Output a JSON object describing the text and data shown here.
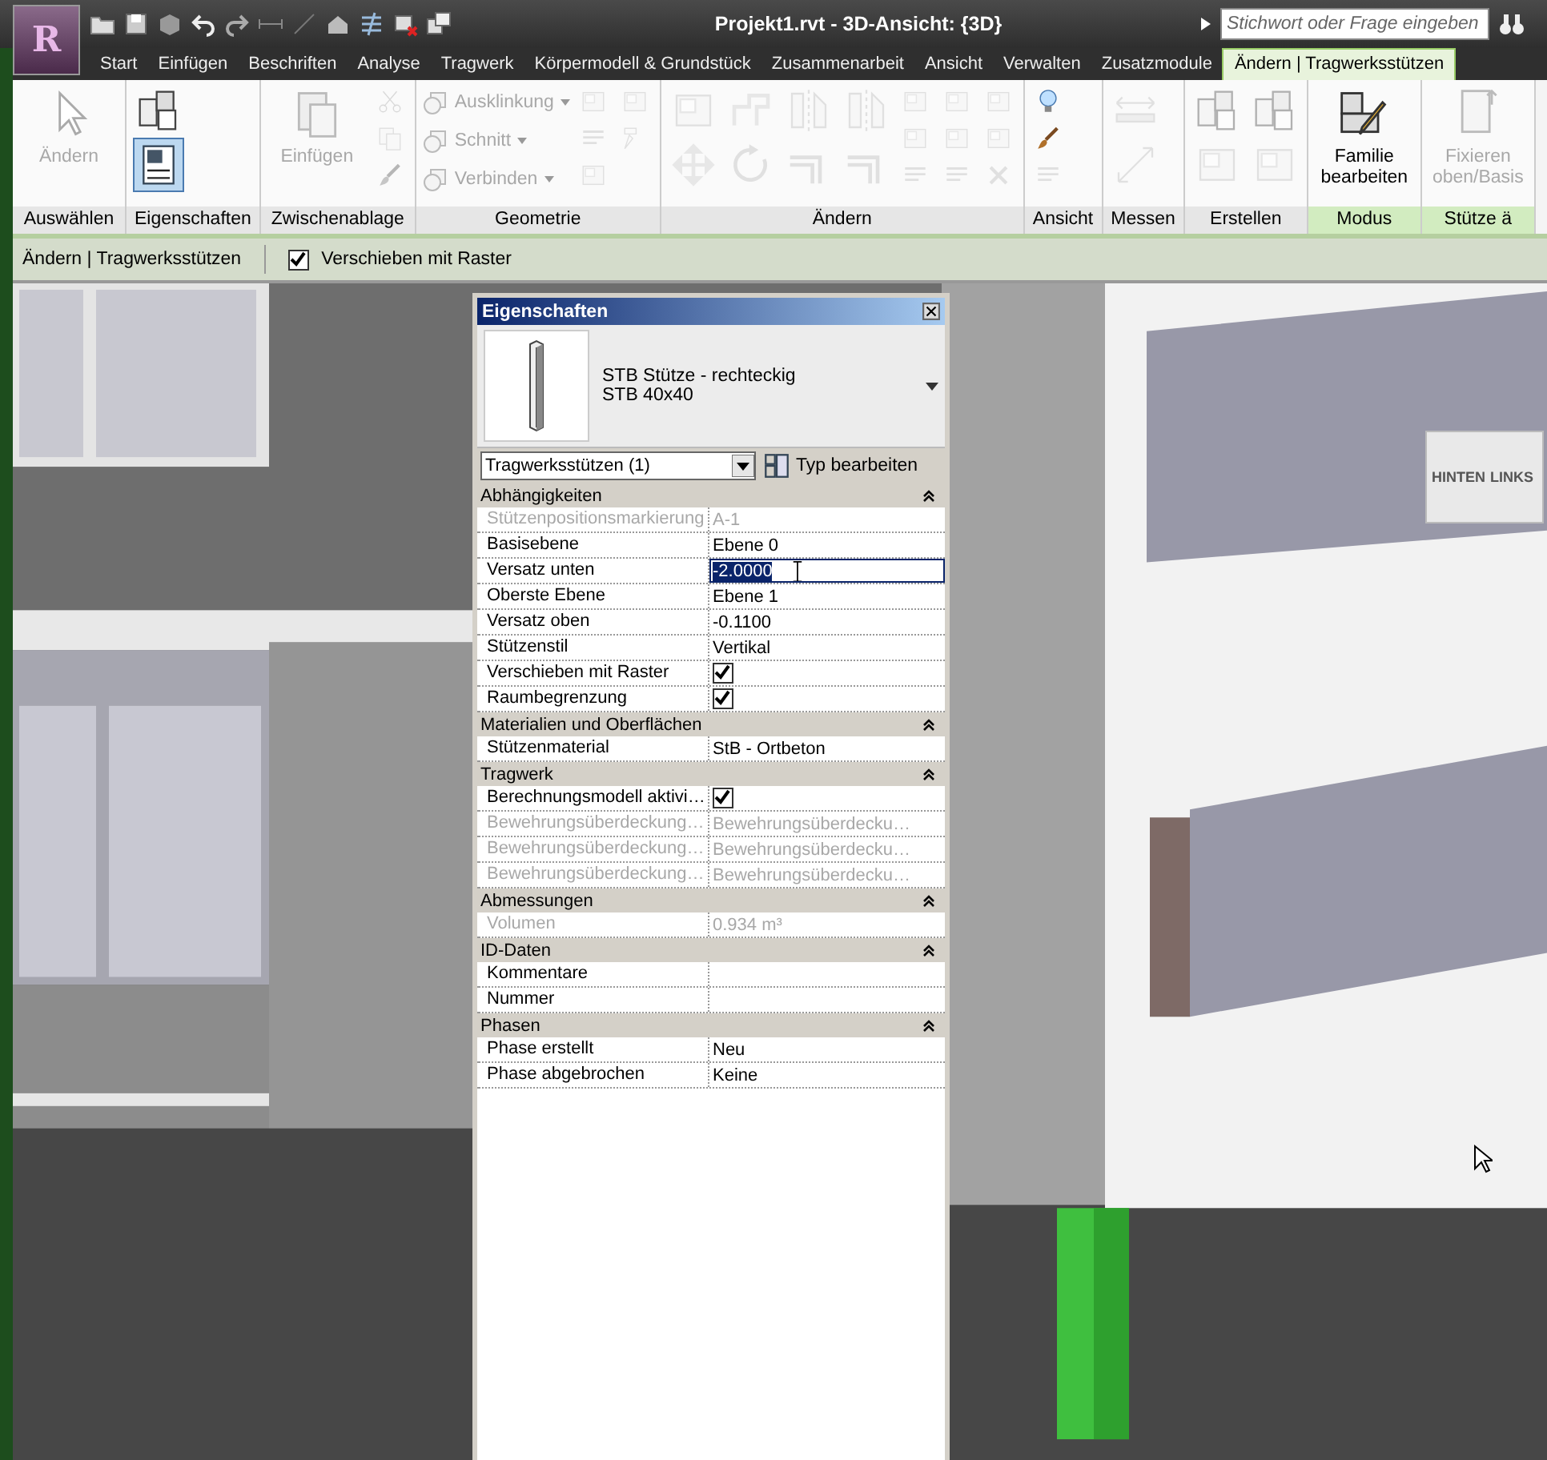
{
  "app_button": {
    "logo": "R"
  },
  "window": {
    "title": "Projekt1.rvt - 3D-Ansicht: {3D}"
  },
  "search": {
    "placeholder": "Stichwort oder Frage eingeben"
  },
  "tabs": [
    {
      "label": "Start",
      "selected": false
    },
    {
      "label": "Einfügen",
      "selected": false
    },
    {
      "label": "Beschriften",
      "selected": false
    },
    {
      "label": "Analyse",
      "selected": false
    },
    {
      "label": "Tragwerk",
      "selected": false
    },
    {
      "label": "Körpermodell & Grundstück",
      "selected": false
    },
    {
      "label": "Zusammenarbeit",
      "selected": false
    },
    {
      "label": "Ansicht",
      "selected": false
    },
    {
      "label": "Verwalten",
      "selected": false
    },
    {
      "label": "Zusatzmodule",
      "selected": false
    },
    {
      "label": "Ändern | Tragwerksstützen",
      "selected": true
    }
  ],
  "ribbon": {
    "panels": [
      {
        "title": "Auswählen",
        "contextual": false,
        "tools": [
          {
            "kind": "large",
            "label": "Ändern",
            "disabled": true,
            "pressed": false
          }
        ]
      },
      {
        "title": "Eigenschaften",
        "contextual": false,
        "tools": [
          {
            "kind": "bigicon",
            "disabled": false,
            "pressed": false
          },
          {
            "kind": "bigicon",
            "disabled": false,
            "pressed": true
          }
        ]
      },
      {
        "title": "Zwischenablage",
        "contextual": false,
        "tools": [
          {
            "kind": "large",
            "label": "Einfügen",
            "disabled": true,
            "pressed": false
          },
          {
            "kind": "icon",
            "disabled": true,
            "pressed": false
          },
          {
            "kind": "icon",
            "disabled": true,
            "pressed": false
          },
          {
            "kind": "icon",
            "disabled": true,
            "pressed": false
          }
        ]
      },
      {
        "title": "Geometrie",
        "contextual": false,
        "tools": [
          {
            "kind": "small",
            "label": "Ausklinkung",
            "disabled": true,
            "pressed": false
          },
          {
            "kind": "small",
            "label": "Schnitt",
            "disabled": true,
            "pressed": false
          },
          {
            "kind": "small",
            "label": "Verbinden",
            "disabled": true,
            "pressed": false
          },
          {
            "kind": "icon",
            "disabled": true,
            "pressed": false
          },
          {
            "kind": "icon",
            "disabled": true,
            "pressed": false
          },
          {
            "kind": "icon",
            "disabled": true,
            "pressed": false
          },
          {
            "kind": "icon",
            "disabled": true,
            "pressed": false
          },
          {
            "kind": "icon",
            "disabled": true,
            "pressed": false
          }
        ]
      },
      {
        "title": "Ändern",
        "contextual": false,
        "tools": [
          {
            "kind": "bigicon",
            "disabled": true,
            "pressed": false
          },
          {
            "kind": "bigicon",
            "disabled": true,
            "pressed": false
          },
          {
            "kind": "bigicon",
            "disabled": true,
            "pressed": false
          },
          {
            "kind": "bigicon",
            "disabled": true,
            "pressed": false
          },
          {
            "kind": "bigicon",
            "disabled": true,
            "pressed": false
          },
          {
            "kind": "bigicon",
            "disabled": true,
            "pressed": false
          },
          {
            "kind": "bigicon",
            "disabled": true,
            "pressed": false
          },
          {
            "kind": "bigicon",
            "disabled": true,
            "pressed": false
          },
          {
            "kind": "icon",
            "disabled": true,
            "pressed": false
          },
          {
            "kind": "icon",
            "disabled": true,
            "pressed": false
          },
          {
            "kind": "icon",
            "disabled": true,
            "pressed": false
          },
          {
            "kind": "icon",
            "disabled": true,
            "pressed": false
          },
          {
            "kind": "icon",
            "disabled": true,
            "pressed": false
          },
          {
            "kind": "icon",
            "disabled": true,
            "pressed": false
          },
          {
            "kind": "icon",
            "disabled": true,
            "pressed": false
          },
          {
            "kind": "icon",
            "disabled": true,
            "pressed": false
          },
          {
            "kind": "icon",
            "disabled": true,
            "pressed": false
          }
        ]
      },
      {
        "title": "Ansicht",
        "contextual": false,
        "tools": [
          {
            "kind": "icon",
            "disabled": false,
            "pressed": false
          },
          {
            "kind": "icon",
            "disabled": false,
            "pressed": false
          },
          {
            "kind": "icon",
            "disabled": true,
            "pressed": false
          }
        ]
      },
      {
        "title": "Messen",
        "contextual": false,
        "tools": [
          {
            "kind": "bigicon",
            "disabled": true,
            "pressed": false
          },
          {
            "kind": "bigicon",
            "disabled": true,
            "pressed": false
          }
        ]
      },
      {
        "title": "Erstellen",
        "contextual": false,
        "tools": [
          {
            "kind": "bigicon",
            "disabled": true,
            "pressed": false
          },
          {
            "kind": "bigicon",
            "disabled": true,
            "pressed": false
          },
          {
            "kind": "bigicon",
            "disabled": true,
            "pressed": false
          },
          {
            "kind": "bigicon",
            "disabled": true,
            "pressed": false
          }
        ]
      },
      {
        "title": "Modus",
        "contextual": true,
        "tools": [
          {
            "kind": "large",
            "label": "Familie bearbeiten",
            "disabled": false,
            "pressed": false
          }
        ]
      },
      {
        "title": "Stütze ä",
        "contextual": true,
        "tools": [
          {
            "kind": "large",
            "label": "Fixieren oben/Basis",
            "disabled": true,
            "pressed": false
          }
        ]
      }
    ]
  },
  "options_bar": {
    "context": "Ändern | Tragwerksstützen",
    "move_with_grid": {
      "label": "Verschieben mit Raster",
      "checked": true
    }
  },
  "view_cube": {
    "faces": [
      "HINTEN",
      "LINKS"
    ]
  },
  "properties": {
    "title": "Eigenschaften",
    "type_name": "STB Stütze - rechteckig",
    "type_size": "STB 40x40",
    "filter": "Tragwerksstützen (1)",
    "edit_type_button": "Typ bearbeiten",
    "groups": [
      {
        "title": "Abhängigkeiten",
        "expanded": true,
        "rows": [
          {
            "label": "Stützenpositionsmarkierung",
            "kind": "text",
            "value": "A-1",
            "disabled": true,
            "selected": false
          },
          {
            "label": "Basisebene",
            "kind": "text",
            "value": "Ebene 0",
            "disabled": false,
            "selected": false
          },
          {
            "label": "Versatz unten",
            "kind": "text",
            "value": "-2.0000",
            "disabled": false,
            "selected": true
          },
          {
            "label": "Oberste Ebene",
            "kind": "text",
            "value": "Ebene 1",
            "disabled": false,
            "selected": false
          },
          {
            "label": "Versatz oben",
            "kind": "text",
            "value": "-0.1100",
            "disabled": false,
            "selected": false
          },
          {
            "label": "Stützenstil",
            "kind": "text",
            "value": "Vertikal",
            "disabled": false,
            "selected": false
          },
          {
            "label": "Verschieben mit Raster",
            "kind": "check",
            "checked": true,
            "disabled": false,
            "selected": false
          },
          {
            "label": "Raumbegrenzung",
            "kind": "check",
            "checked": true,
            "disabled": false,
            "selected": false
          }
        ]
      },
      {
        "title": "Materialien und Oberflächen",
        "expanded": true,
        "rows": [
          {
            "label": "Stützenmaterial",
            "kind": "text",
            "value": "StB - Ortbeton",
            "disabled": false,
            "selected": false
          }
        ]
      },
      {
        "title": "Tragwerk",
        "expanded": true,
        "rows": [
          {
            "label": "Berechnungsmodell aktivi…",
            "kind": "check",
            "checked": true,
            "disabled": false,
            "selected": false
          },
          {
            "label": "Bewehrungsüberdeckung…",
            "kind": "text",
            "value": "Bewehrungsüberdecku…",
            "disabled": true,
            "selected": false
          },
          {
            "label": "Bewehrungsüberdeckung…",
            "kind": "text",
            "value": "Bewehrungsüberdecku…",
            "disabled": true,
            "selected": false
          },
          {
            "label": "Bewehrungsüberdeckung…",
            "kind": "text",
            "value": "Bewehrungsüberdecku…",
            "disabled": true,
            "selected": false
          }
        ]
      },
      {
        "title": "Abmessungen",
        "expanded": true,
        "rows": [
          {
            "label": "Volumen",
            "kind": "text",
            "value": "0.934 m³",
            "disabled": true,
            "selected": false
          }
        ]
      },
      {
        "title": "ID-Daten",
        "expanded": true,
        "rows": [
          {
            "label": "Kommentare",
            "kind": "text",
            "disabled": false,
            "selected": false
          },
          {
            "label": "Nummer",
            "kind": "text",
            "disabled": false,
            "selected": false
          }
        ]
      },
      {
        "title": "Phasen",
        "expanded": true,
        "rows": [
          {
            "label": "Phase erstellt",
            "kind": "text",
            "value": "Neu",
            "disabled": false,
            "selected": false
          },
          {
            "label": "Phase abgebrochen",
            "kind": "text",
            "value": "Keine",
            "disabled": false,
            "selected": false
          }
        ]
      }
    ]
  }
}
